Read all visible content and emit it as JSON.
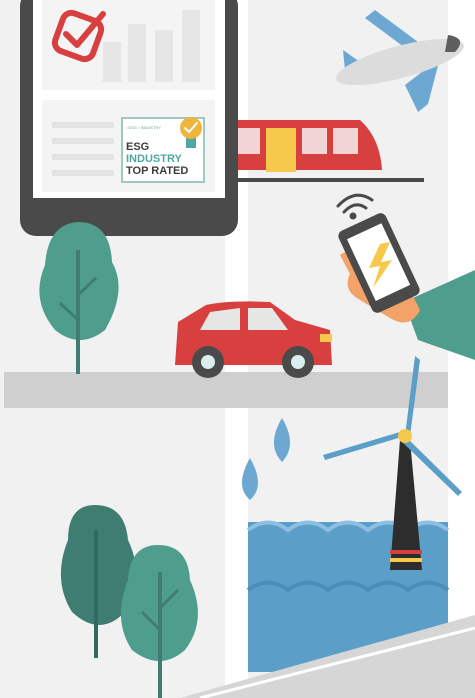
{
  "illustration": {
    "badge": {
      "top_line": "ESG",
      "middle_line": "INDUSTRY",
      "bottom_line": "TOP RATED",
      "top_microtext": "• ESG • INDUSTRY"
    },
    "icons": {
      "checkmark": "checkmark-badge-icon",
      "plane": "airplane-icon",
      "train": "train-icon",
      "car": "car-icon",
      "phone": "smartphone-charging-icon",
      "wifi": "wifi-signal-icon",
      "turbine": "wind-turbine-icon",
      "trees": "tree-icon",
      "drops": "water-drop-icon",
      "medal": "ribbon-medal-icon"
    },
    "colors": {
      "accent_red": "#d84040",
      "tree_green": "#4f9d8d",
      "tree_dark_green": "#3f7d72",
      "sky_blue": "#7fb3d4",
      "water_blue": "#5b9fc9",
      "phone_bolt": "#f6c94c",
      "frame_grey": "#4a4a4a",
      "road_grey": "#cfcfcf",
      "background_grey": "#f0f0f0"
    }
  }
}
